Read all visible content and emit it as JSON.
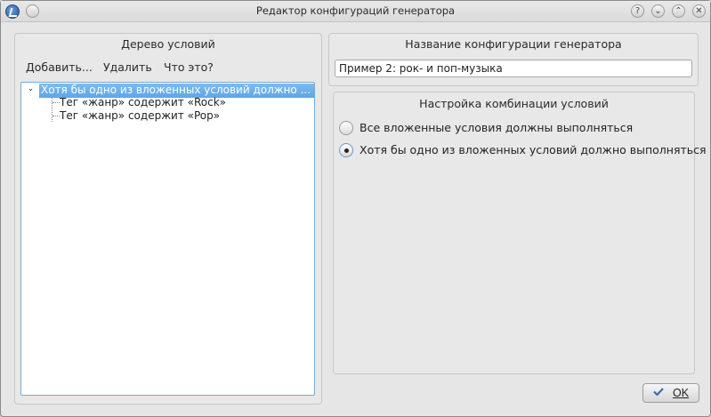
{
  "window": {
    "title": "Редактор конфигураций генератора",
    "buttons": {
      "help": "?",
      "minimize": "⌄",
      "maximize": "⌃",
      "close": "✕"
    }
  },
  "left_panel": {
    "title": "Дерево условий",
    "menu": [
      "Добавить...",
      "Удалить",
      "Что это?"
    ],
    "tree": {
      "root_label": "Хотя бы одно из вложенных условий должно ...",
      "children": [
        "Тег «жанр»  содержит «Rock»",
        "Тег «жанр»  содержит «Pop»"
      ]
    }
  },
  "right_panel": {
    "title": "Название конфигурации генератора",
    "name_value": "Пример 2: рок- и поп-музыка",
    "combo": {
      "title": "Настройка комбинации условий",
      "options": [
        {
          "label": "Все вложенные условия должны выполняться",
          "checked": false
        },
        {
          "label": "Хотя бы одно из вложенных условий должно выполняться",
          "checked": true
        }
      ]
    }
  },
  "footer": {
    "ok_label": "OK"
  },
  "colors": {
    "selection": "#5ea6e8",
    "tree_border": "#79a8d8"
  }
}
